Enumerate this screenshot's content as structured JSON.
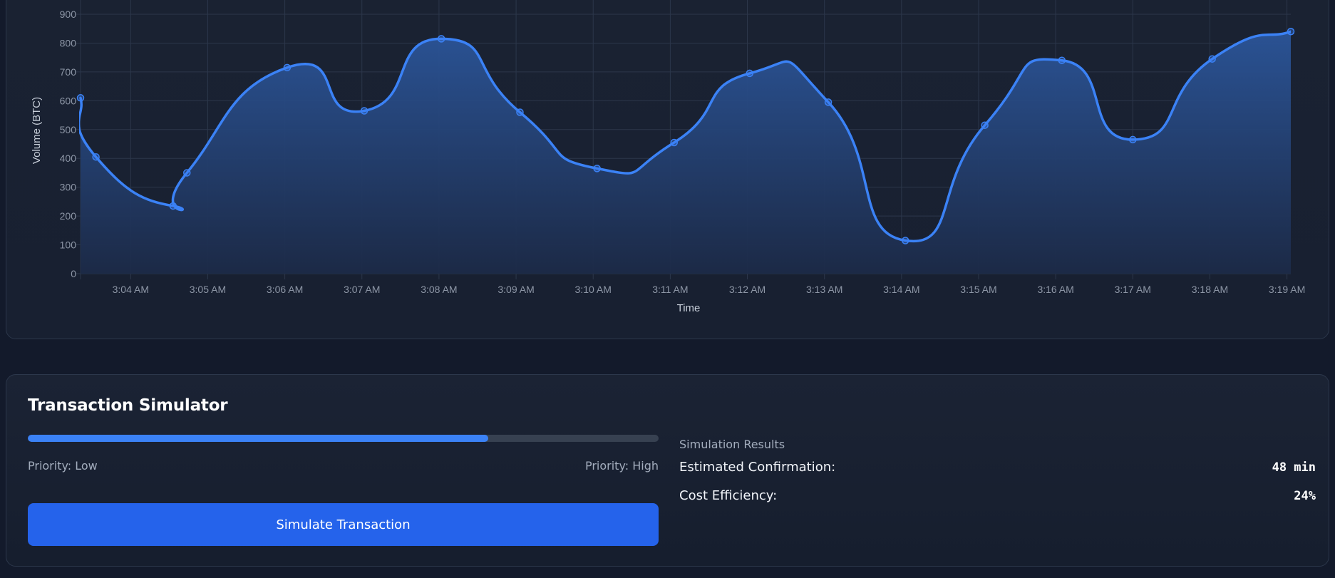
{
  "chart": {
    "chart_data": {
      "type": "area",
      "xlabel": "Time",
      "ylabel": "Volume (BTC)",
      "ylim": [
        0,
        900
      ],
      "yticks": [
        0,
        100,
        200,
        300,
        400,
        500,
        600,
        700,
        800,
        900
      ],
      "x_tick_labels": [
        "3:04 AM",
        "3:05 AM",
        "3:06 AM",
        "3:07 AM",
        "3:08 AM",
        "3:09 AM",
        "3:10 AM",
        "3:11 AM",
        "3:12 AM",
        "3:13 AM",
        "3:14 AM",
        "3:15 AM",
        "3:16 AM",
        "3:17 AM",
        "3:18 AM",
        "3:19 AM"
      ],
      "x_tick_minutes": [
        184,
        185,
        186,
        187,
        188,
        189,
        190,
        191,
        192,
        193,
        194,
        195,
        196,
        197,
        198,
        199
      ],
      "x_range_minutes": [
        183.35,
        199.05
      ],
      "grid": true,
      "series": [
        {
          "x_minutes": [
            183.35,
            183.55,
            184.55,
            184.73,
            186.03,
            187.03,
            188.03,
            189.05,
            190.05,
            191.05,
            192.03,
            193.05,
            194.05,
            195.08,
            196.08,
            197.0,
            198.03,
            199.05
          ],
          "values": [
            610,
            405,
            235,
            350,
            715,
            565,
            815,
            560,
            365,
            455,
            695,
            595,
            115,
            515,
            740,
            465,
            745,
            840
          ]
        }
      ]
    },
    "colors": {
      "line": "#3b82f6",
      "grid": "#2c374b",
      "fill_top": "#2b5599",
      "fill_bottom": "#1c2a47"
    }
  },
  "simulator": {
    "title": "Transaction Simulator",
    "priority_value_percent": 73,
    "priority_low_label": "Priority: Low",
    "priority_high_label": "Priority: High",
    "button_label": "Simulate Transaction",
    "results_heading": "Simulation Results",
    "results": [
      {
        "label": "Estimated Confirmation:",
        "value": "48 min"
      },
      {
        "label": "Cost Efficiency:",
        "value": "24%"
      }
    ],
    "colors": {
      "accent": "#2563eb",
      "slider_fill": "#3b82f6",
      "slider_track": "#374151"
    }
  }
}
